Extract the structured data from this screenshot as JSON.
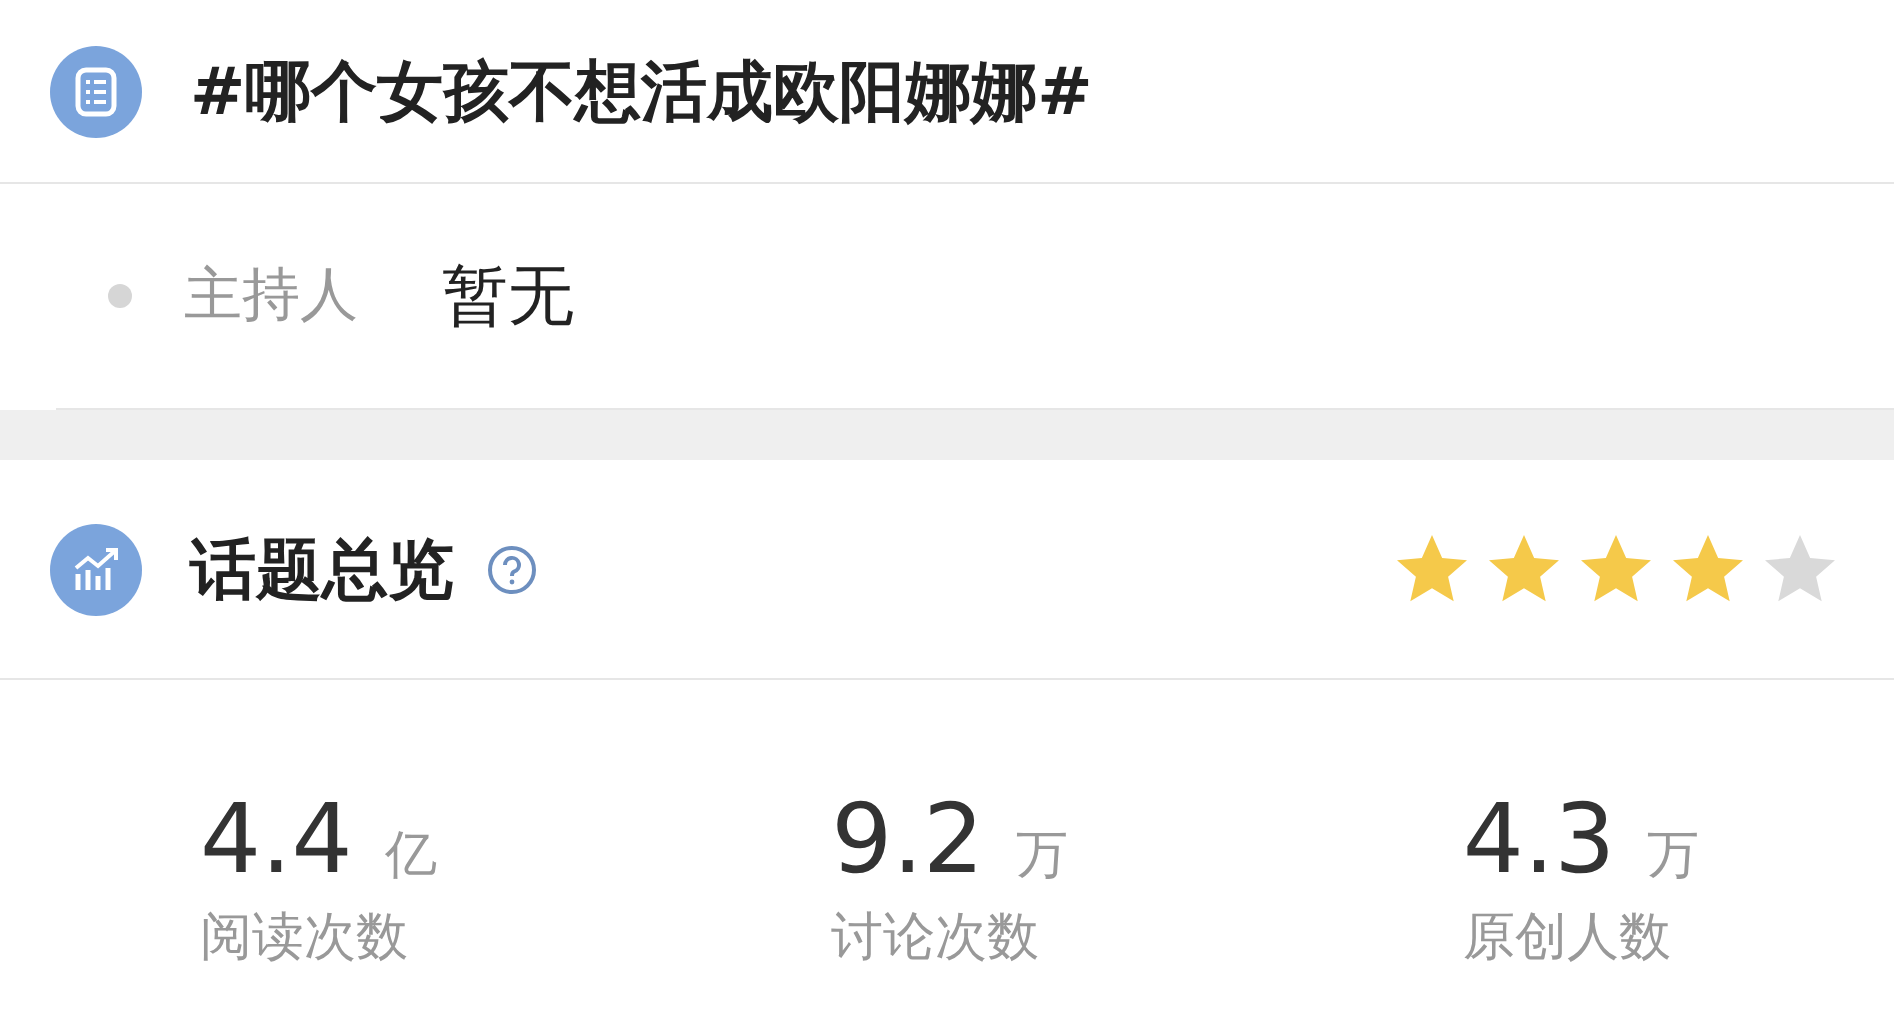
{
  "topic": {
    "title": "#哪个女孩不想活成欧阳娜娜#"
  },
  "host": {
    "label": "主持人",
    "value": "暂无"
  },
  "overview": {
    "title": "话题总览",
    "stars": 4
  },
  "stats": [
    {
      "value": "4.4",
      "unit": "亿",
      "label": "阅读次数"
    },
    {
      "value": "9.2",
      "unit": "万",
      "label": "讨论次数"
    },
    {
      "value": "4.3",
      "unit": "万",
      "label": "原创人数"
    }
  ]
}
